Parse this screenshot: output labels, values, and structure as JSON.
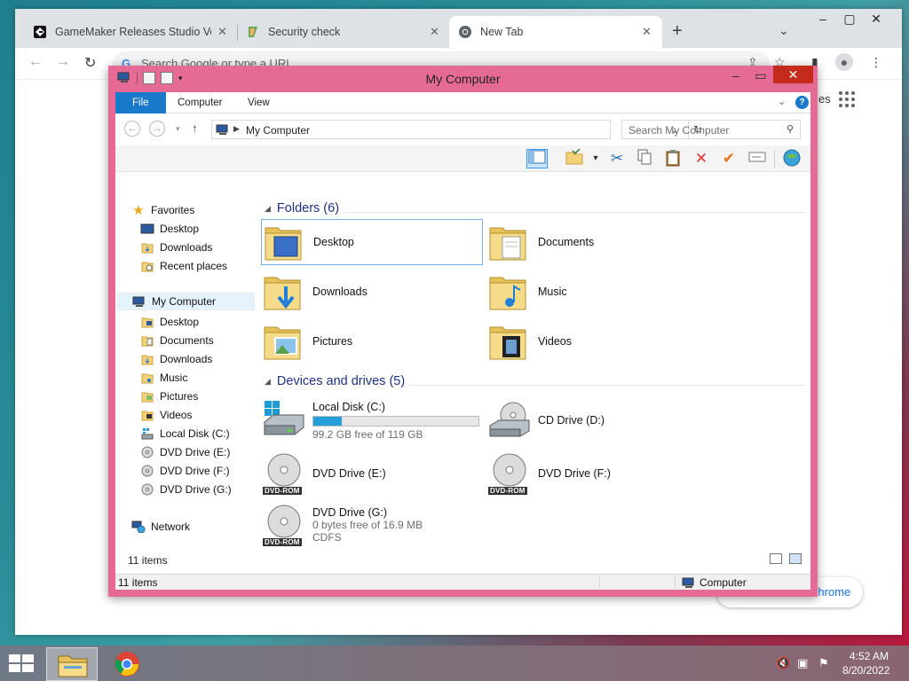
{
  "chrome": {
    "tabs": [
      {
        "title": "GameMaker Releases Studio Versi",
        "active": false
      },
      {
        "title": "Security check",
        "active": false
      },
      {
        "title": "New Tab",
        "active": true
      }
    ],
    "new_tab": "+",
    "omnibox_placeholder": "Search Google or type a URL",
    "partial_text_right": "es",
    "customize_label": "Customize Chrome"
  },
  "explorer": {
    "title": "My Computer",
    "ribbon_tabs": {
      "file": "File",
      "computer": "Computer",
      "view": "View"
    },
    "address": "My Computer",
    "search_placeholder": "Search My Computer",
    "nav": {
      "favorites": "Favorites",
      "fav_desktop": "Desktop",
      "fav_downloads": "Downloads",
      "fav_recent": "Recent places",
      "my_computer": "My Computer",
      "desktop": "Desktop",
      "documents": "Documents",
      "downloads": "Downloads",
      "music": "Music",
      "pictures": "Pictures",
      "videos": "Videos",
      "local_disk": "Local Disk (C:)",
      "dvd_e": "DVD Drive (E:)",
      "dvd_f": "DVD Drive (F:)",
      "dvd_g": "DVD Drive (G:)",
      "network": "Network"
    },
    "folders_header": "Folders (6)",
    "folders": {
      "desktop": "Desktop",
      "documents": "Documents",
      "downloads": "Downloads",
      "music": "Music",
      "pictures": "Pictures",
      "videos": "Videos"
    },
    "drives_header": "Devices and drives (5)",
    "drives": {
      "c_name": "Local Disk (C:)",
      "c_free": "99.2 GB free of 119 GB",
      "c_used_fraction": 0.17,
      "d_name": "CD Drive (D:)",
      "e_name": "DVD Drive (E:)",
      "f_name": "DVD Drive (F:)",
      "g_name": "DVD Drive (G:)",
      "g_free": "0 bytes free of 16.9 MB",
      "g_fs": "CDFS",
      "dvd_badge": "DVD-ROM"
    },
    "items_count_inner": "11 items",
    "status_left": "11 items",
    "status_right": "Computer"
  },
  "taskbar": {
    "time": "4:52 AM",
    "date": "8/20/2022"
  },
  "colors": {
    "window_frame": "#e56a96",
    "accent_blue": "#1979ca",
    "close_red": "#c42b1c"
  }
}
